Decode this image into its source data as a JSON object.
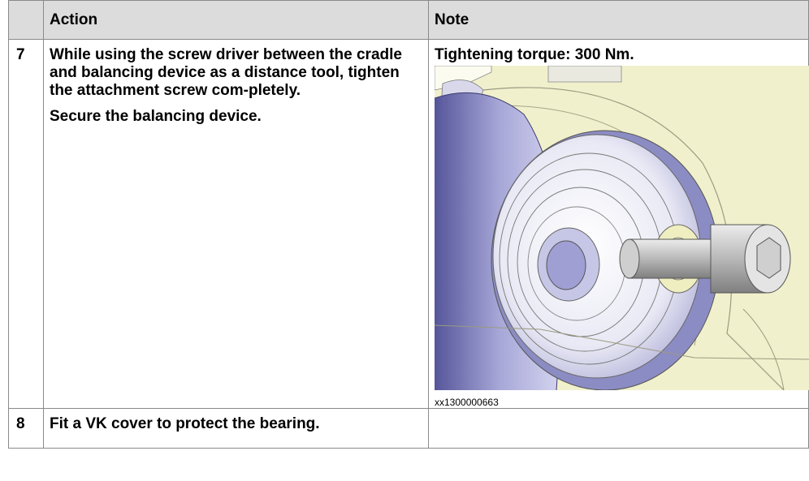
{
  "table": {
    "headers": {
      "number": "",
      "action": "Action",
      "note": "Note"
    },
    "rows": [
      {
        "number": "7",
        "action": [
          "While using the screw driver between the cradle and balancing device as a distance tool, tighten the attachment screw com-pletely.",
          "Secure the balancing device."
        ],
        "note": "Tightening torque: 300 Nm.",
        "figure_caption": "xx1300000663"
      },
      {
        "number": "8",
        "action": [
          "Fit a VK cover to protect the bearing."
        ],
        "note": ""
      }
    ]
  },
  "colors": {
    "header_bg": "#dcdcdc",
    "border": "#8a8a8a",
    "bracket_fill": "#f3f2cf",
    "bracket_shadow": "#6f6fa8",
    "bearing_blue": "#a9a9d6"
  }
}
